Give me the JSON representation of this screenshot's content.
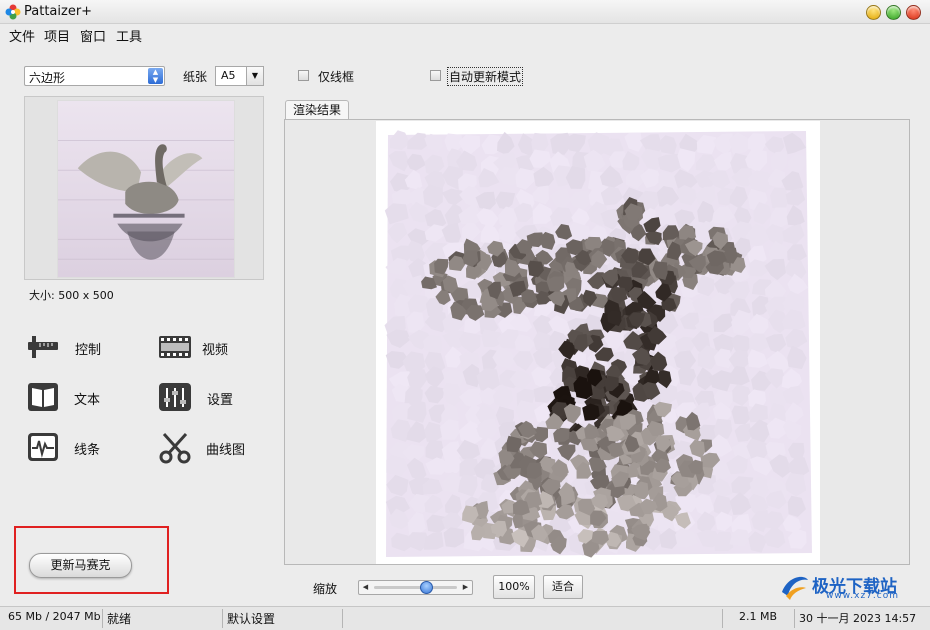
{
  "window": {
    "title": "Pattaizer+"
  },
  "menu": [
    "文件",
    "项目",
    "窗口",
    "工具"
  ],
  "toolbar": {
    "shape_value": "六边形",
    "paper_label": "纸张",
    "paper_value": "A5",
    "outline_only_label": "仅线框",
    "outline_only_checked": false,
    "auto_update_label": "自动更新模式",
    "auto_update_checked": false
  },
  "source": {
    "size_label": "大小: 500 x 500"
  },
  "tools": {
    "control": "控制",
    "video": "视频",
    "text": "文本",
    "settings": "设置",
    "lines": "线条",
    "curves": "曲线图"
  },
  "update_button_label": "更新马赛克",
  "render": {
    "tab_label": "渲染结果"
  },
  "zoom": {
    "label": "缩放",
    "slider_fraction": 0.65,
    "percent_button": "100%",
    "fit_button": "适合"
  },
  "status": {
    "memory": "65 Mb / 2047 Mb",
    "state": "就绪",
    "preset": "默认设置",
    "file_size": "2.1 MB",
    "datetime": "30 十一月 2023   14:57"
  },
  "watermark": {
    "text": "极光下载站",
    "sub": "www.xz7.com"
  },
  "colors": {
    "highlight": "#e02020",
    "slider_knob": "#3776d8",
    "watermark": "#1e63c4"
  }
}
